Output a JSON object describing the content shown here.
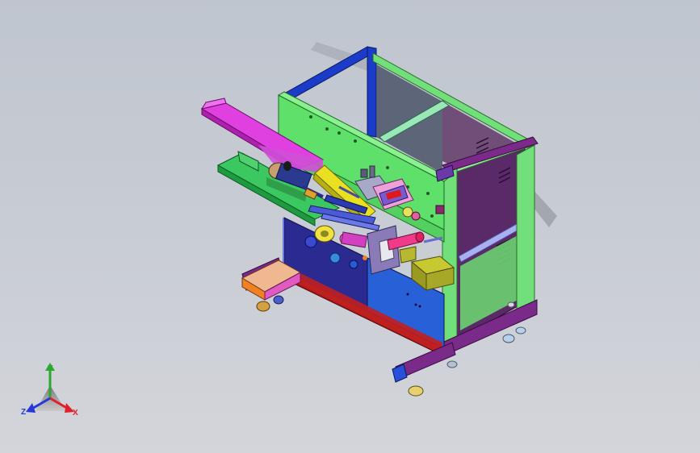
{
  "viewport": {
    "background_top": "#bfc5cf",
    "background_bottom": "#d3d5da"
  },
  "model": {
    "icon": "machine-assembly-model"
  },
  "triad": {
    "x_label": "X",
    "y_label": "Y",
    "z_label": "Z",
    "x_color": "#e0202a",
    "y_color": "#2aa830",
    "z_color": "#2538d8"
  },
  "colors": {
    "frame_green": "#72e07a",
    "panel_green": "#5ee06a",
    "frame_blue": "#1a3cc8",
    "frame_purple": "#7a2a88",
    "chute_magenta": "#e040e0",
    "chute_green": "#3cc860",
    "rail_yellow": "#e8e020",
    "base_red": "#b01818",
    "cabinet_navy": "#2a2a90",
    "accent_orange": "#f08020",
    "box_olive": "#9a9a20"
  }
}
